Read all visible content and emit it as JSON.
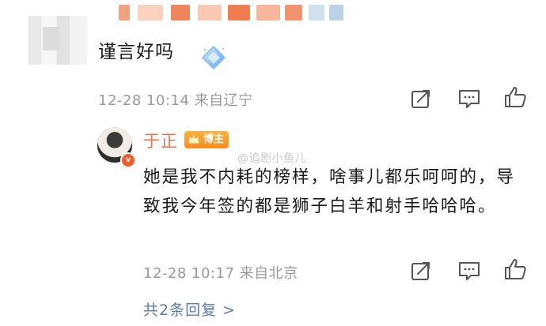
{
  "comment": {
    "text": "谨言好吗",
    "time": "12-28 10:14",
    "location": "来自辽宁",
    "emoji": "diamond-sticker"
  },
  "reply": {
    "author": "于正",
    "badge": "博主",
    "watermark": "@追剧小鱼儿",
    "body": "她是我不内耗的榜样，啥事儿都乐呵呵的，导致我今年签的都是狮子白羊和射手哈哈哈。",
    "time": "12-28 10:17",
    "location": "来自北京",
    "reply_count_label": "共2条回复 >"
  },
  "colors": {
    "name_orange": "#eb7350",
    "link_blue": "#5b7da8",
    "meta_gray": "#9a9a9a",
    "badge_orange": "#ff9a2b"
  },
  "icons": [
    "share-icon",
    "comment-icon",
    "like-icon",
    "verified-icon",
    "crown-icon"
  ]
}
